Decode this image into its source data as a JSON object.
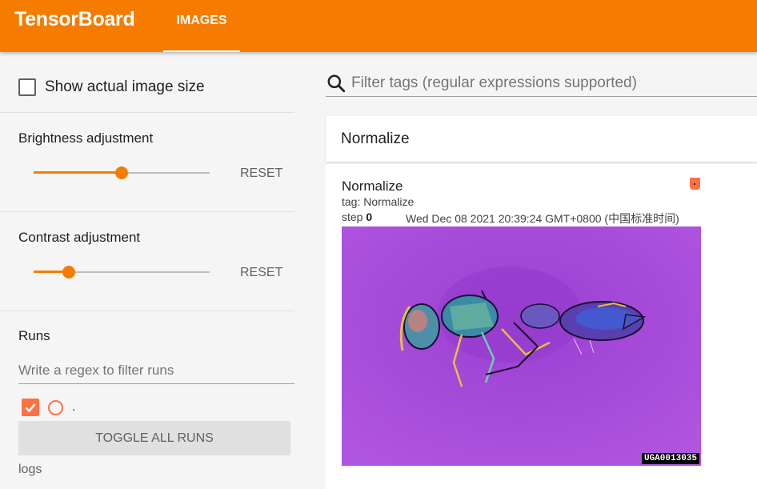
{
  "app": {
    "title": "TensorBoard",
    "tab": "IMAGES",
    "accent": "#f57c00"
  },
  "sidebar": {
    "show_actual_size_label": "Show actual image size",
    "brightness": {
      "title": "Brightness adjustment",
      "reset": "RESET",
      "value": 0.5
    },
    "contrast": {
      "title": "Contrast adjustment",
      "reset": "RESET",
      "value": 0.2
    },
    "runs": {
      "title": "Runs",
      "filter_placeholder": "Write a regex to filter runs",
      "run_name": ".",
      "toggle_label": "TOGGLE ALL RUNS",
      "footer": "logs",
      "color": "#ff7043"
    }
  },
  "main": {
    "filter_placeholder": "Filter tags (regular expressions supported)",
    "category_title": "Normalize",
    "card": {
      "title": "Normalize",
      "tag": "tag: Normalize",
      "step_label": "step",
      "step_value": "0",
      "timestamp": "Wed Dec 08 2021 20:39:24 GMT+0800 (中国标准时间)",
      "watermark": "UGA0013035"
    }
  }
}
